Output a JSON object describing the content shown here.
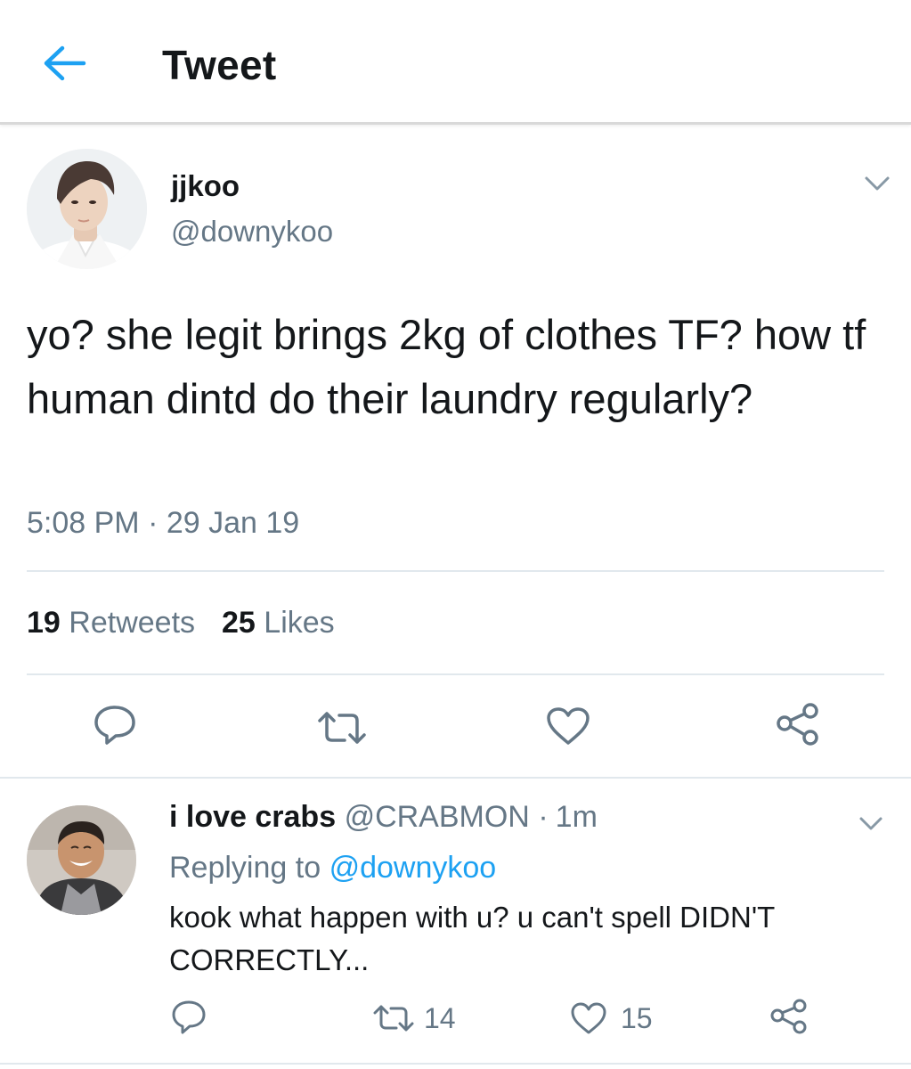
{
  "header": {
    "title": "Tweet",
    "back_icon": "arrow-left-icon",
    "accent": "#1da1f2"
  },
  "tweet": {
    "author_name": "jjkoo",
    "author_handle": "@downykoo",
    "text": "yo? she legit brings 2kg of clothes TF? how tf human dintd do their laundry regularly?",
    "time": "5:08 PM · 29 Jan 19",
    "retweets_count": "19",
    "retweets_label": "Retweets",
    "likes_count": "25",
    "likes_label": "Likes",
    "actions": [
      "reply-icon",
      "retweet-icon",
      "like-icon",
      "share-icon"
    ]
  },
  "reply": {
    "author_name": "i love crabs",
    "author_handle": "@CRABMON",
    "separator": "·",
    "time": "1m",
    "replying_label": "Replying to",
    "replying_to": "@downykoo",
    "text": "kook what happen with u? u can't spell DIDN'T CORRECTLY...",
    "retweets": "14",
    "likes": "15"
  },
  "colors": {
    "text_primary": "#14171a",
    "text_secondary": "#657786",
    "link": "#1da1f2",
    "divider": "#e1e8ed"
  }
}
